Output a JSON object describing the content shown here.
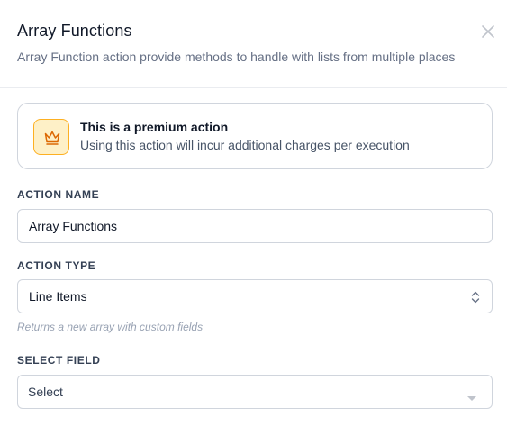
{
  "header": {
    "title": "Array Functions",
    "subtitle": "Array Function action provide methods to handle with lists from multiple places",
    "close_icon": "close-icon"
  },
  "premium": {
    "icon": "crown-icon",
    "title": "This is a premium action",
    "description": "Using this action will incur additional charges per execution",
    "colors": {
      "icon_bg": "#fef0c7",
      "icon_border": "#fdb022",
      "icon_stroke": "#dc6803"
    }
  },
  "form": {
    "action_name": {
      "label": "ACTION NAME",
      "value": "Array Functions"
    },
    "action_type": {
      "label": "ACTION TYPE",
      "selected": "Line Items",
      "icon": "up-down-chevron-icon",
      "help": "Returns a new array with custom fields"
    },
    "select_field": {
      "label": "SELECT FIELD",
      "selected": "Select",
      "icon": "caret-down-icon"
    }
  }
}
